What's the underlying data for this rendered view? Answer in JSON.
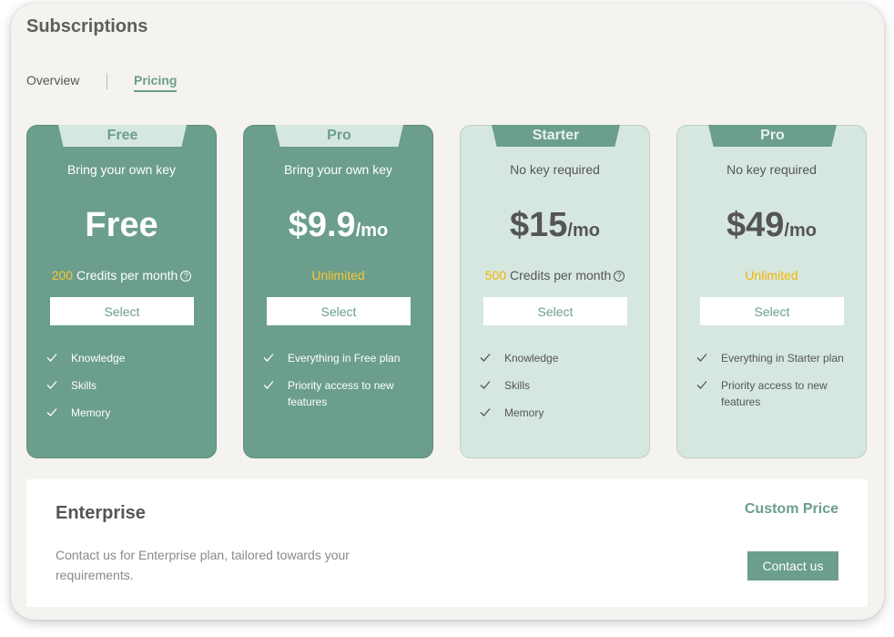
{
  "title": "Subscriptions",
  "tabs": [
    {
      "label": "Overview",
      "active": false
    },
    {
      "label": "Pricing",
      "active": true
    }
  ],
  "colors": {
    "accent": "#6b9e8c",
    "light_card": "#d6e7e0",
    "highlight": "#f7c634",
    "panel_bg": "#f5f3ef"
  },
  "plans": [
    {
      "tag": "Free",
      "subtitle": "Bring your own key",
      "price": "Free",
      "unit": "",
      "credits_value": "200",
      "credits_label": "Credits per month",
      "button": "Select",
      "features": [
        "Knowledge",
        "Skills",
        "Memory"
      ]
    },
    {
      "tag": "Pro",
      "subtitle": "Bring your own key",
      "price": "$9.9",
      "unit": "/mo",
      "credits_value": "Unlimited",
      "credits_label": "",
      "button": "Select",
      "features": [
        "Everything in Free plan",
        "Priority access to new features"
      ]
    },
    {
      "tag": "Starter",
      "subtitle": "No key required",
      "price": "$15",
      "unit": "/mo",
      "credits_value": "500",
      "credits_label": "Credits per month",
      "button": "Select",
      "features": [
        "Knowledge",
        "Skills",
        "Memory"
      ]
    },
    {
      "tag": "Pro",
      "subtitle": "No key required",
      "price": "$49",
      "unit": "/mo",
      "credits_value": "Unlimited",
      "credits_label": "",
      "button": "Select",
      "features": [
        "Everything in Starter plan",
        "Priority access to new features"
      ]
    }
  ],
  "enterprise": {
    "title": "Enterprise",
    "description": "Contact us for Enterprise plan, tailored towards your requirements.",
    "price": "Custom Price",
    "button": "Contact us"
  }
}
